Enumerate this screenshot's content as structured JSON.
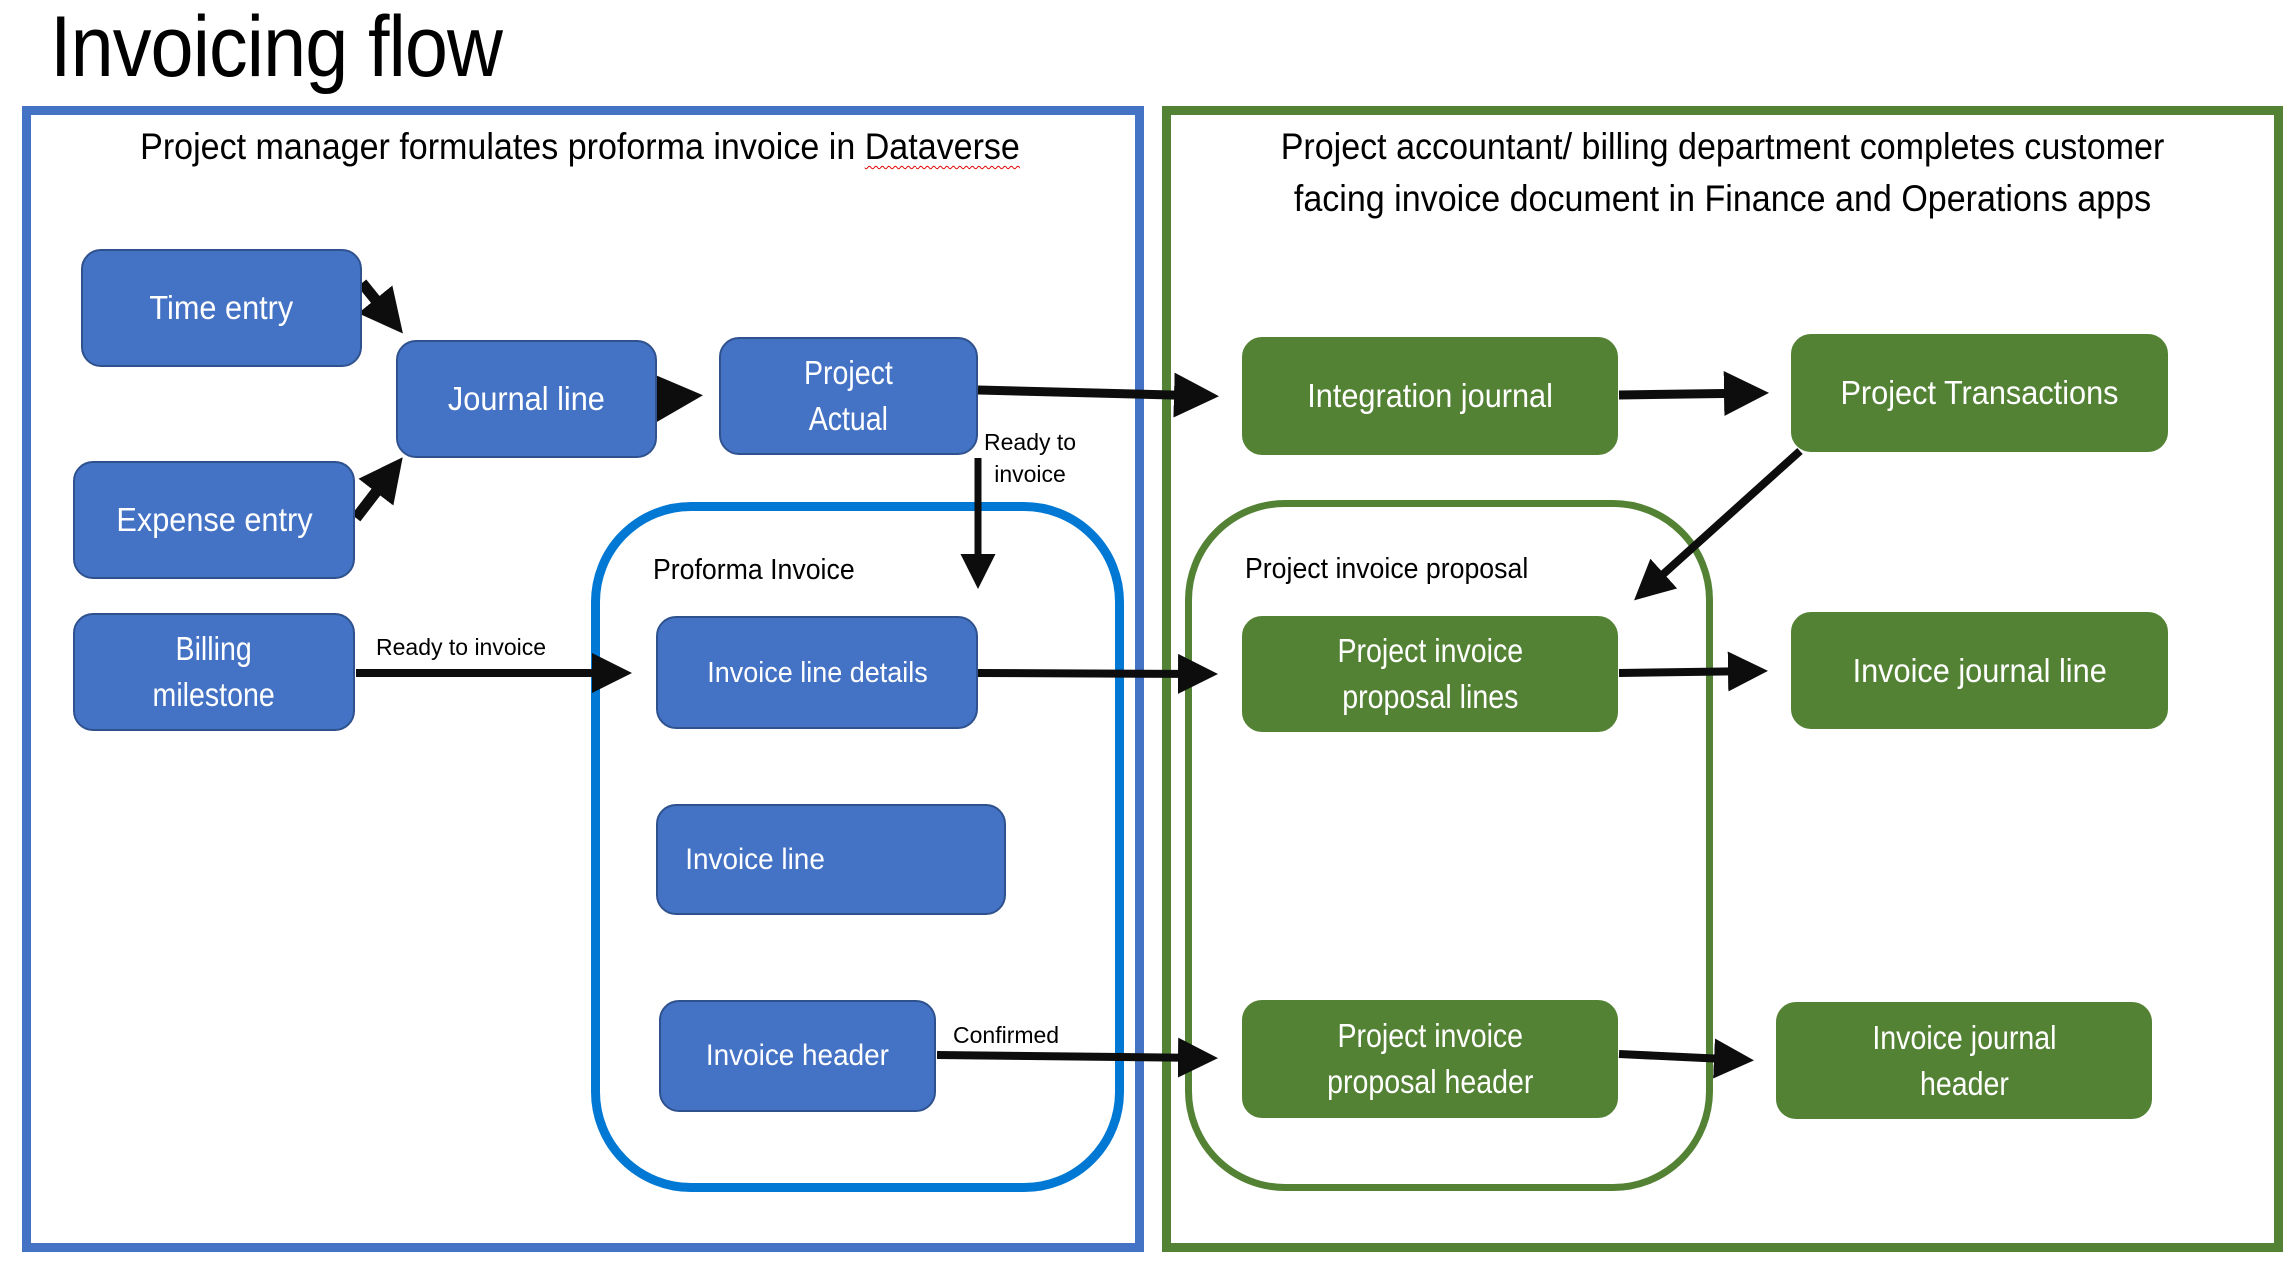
{
  "title": "Invoicing flow",
  "lanes": {
    "left": {
      "title_before": "Project manager formulates proforma invoice in ",
      "title_flagged_word": "Dataverse",
      "color": "#4472C4"
    },
    "right": {
      "title_line1": "Project accountant/ billing department completes customer",
      "title_line2": "facing invoice document in Finance and Operations apps",
      "color": "#548235"
    }
  },
  "containers": {
    "proforma": {
      "label": "Proforma Invoice",
      "color": "#0078D4"
    },
    "proposal": {
      "label": "Project invoice proposal",
      "color": "#548235"
    }
  },
  "nodes": {
    "time_entry": "Time entry",
    "expense_entry": "Expense entry",
    "journal_line": "Journal line",
    "project_actual": {
      "line1": "Project",
      "line2": "Actual"
    },
    "billing_milestone": {
      "line1": "Billing",
      "line2": "milestone"
    },
    "invoice_line_details": "Invoice line details",
    "invoice_line": "Invoice line",
    "invoice_header": "Invoice header",
    "integration_journal": "Integration journal",
    "project_transactions": "Project Transactions",
    "proposal_lines": {
      "line1": "Project invoice",
      "line2": "proposal lines"
    },
    "invoice_journal_line": "Invoice journal line",
    "proposal_header": {
      "line1": "Project invoice",
      "line2": "proposal header"
    },
    "invoice_journal_header": {
      "line1": "Invoice journal",
      "line2": "header"
    }
  },
  "edge_labels": {
    "actual_ready": {
      "line1": "Ready to",
      "line2": "invoice"
    },
    "milestone_ready": "Ready to invoice",
    "header_confirmed": "Confirmed"
  },
  "edges": [
    {
      "from": "Time entry",
      "to": "Journal line"
    },
    {
      "from": "Expense entry",
      "to": "Journal line"
    },
    {
      "from": "Journal line",
      "to": "Project Actual"
    },
    {
      "from": "Project Actual",
      "to": "Integration journal"
    },
    {
      "from": "Project Actual",
      "to": "Invoice line details",
      "label": "Ready to invoice"
    },
    {
      "from": "Billing milestone",
      "to": "Invoice line details",
      "label": "Ready to invoice"
    },
    {
      "from": "Invoice line details",
      "to": "Project invoice proposal lines"
    },
    {
      "from": "Integration journal",
      "to": "Project Transactions"
    },
    {
      "from": "Project Transactions",
      "to": "Project invoice proposal lines"
    },
    {
      "from": "Project invoice proposal lines",
      "to": "Invoice journal line"
    },
    {
      "from": "Invoice header",
      "to": "Project invoice proposal header",
      "label": "Confirmed"
    },
    {
      "from": "Project invoice proposal header",
      "to": "Invoice journal header"
    }
  ]
}
